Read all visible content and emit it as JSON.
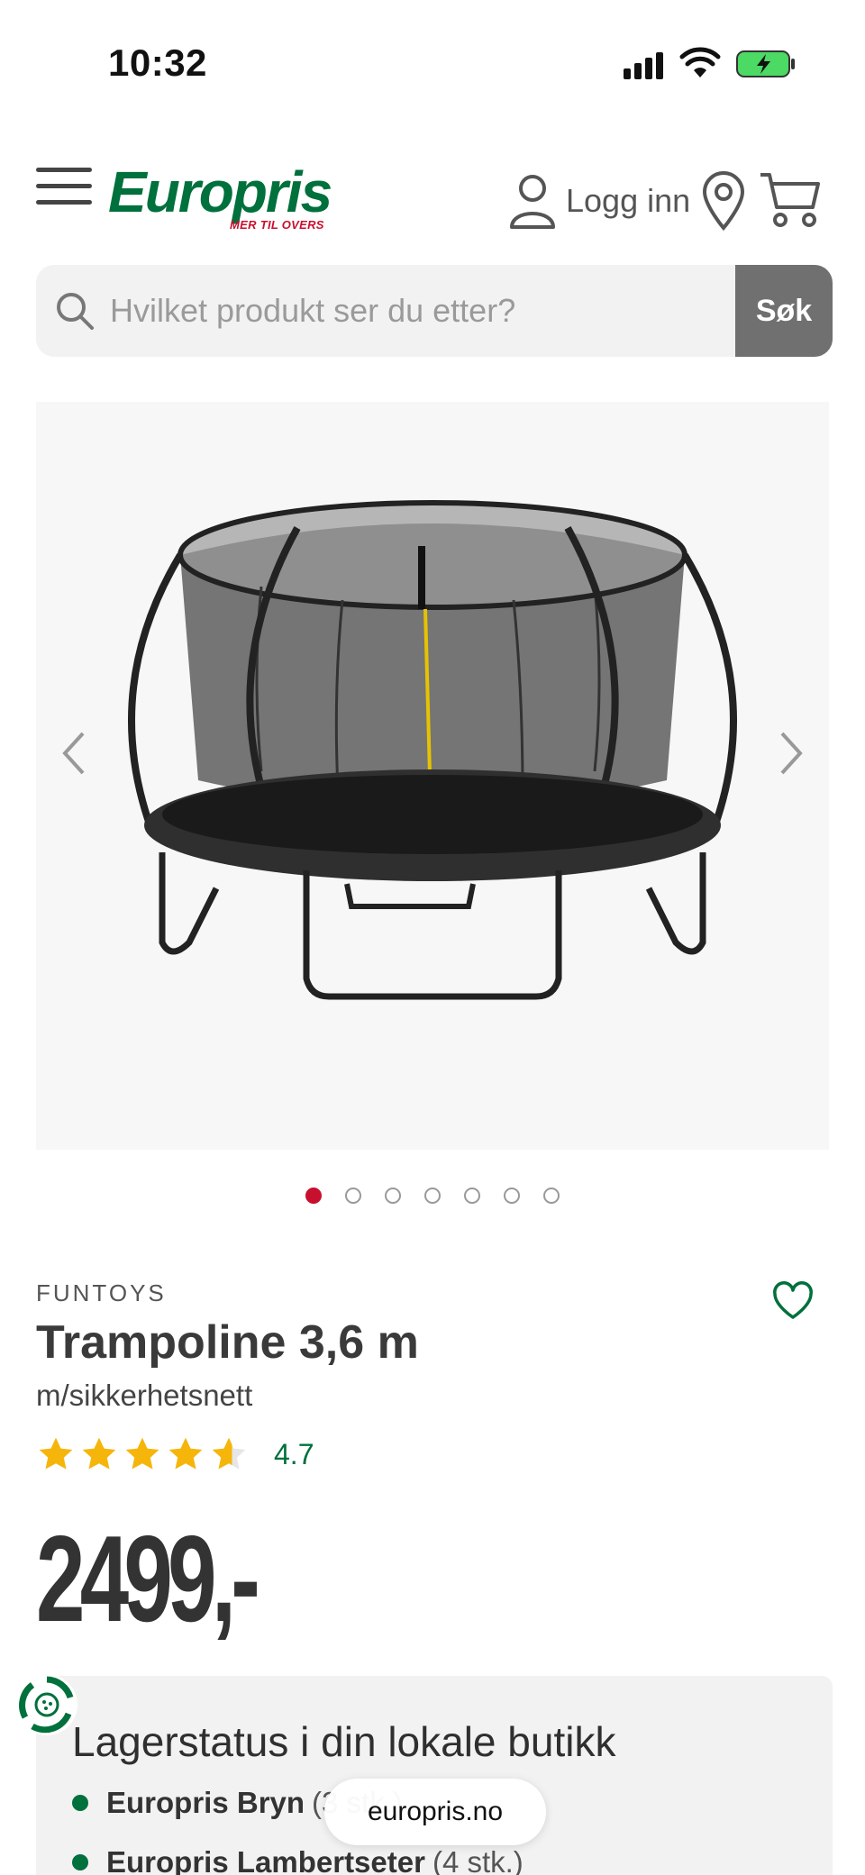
{
  "status_bar": {
    "time": "10:32"
  },
  "header": {
    "logo_text": "Europris",
    "logo_tagline": "MER TIL OVERS",
    "login_label": "Logg inn",
    "brand_color": "#00703c",
    "accent_color": "#c8102e"
  },
  "search": {
    "placeholder": "Hvilket produkt ser du etter?",
    "value": "",
    "button_label": "Søk"
  },
  "gallery": {
    "image_count": 7,
    "active_index": 0,
    "image_icon": "trampoline-product-image"
  },
  "product": {
    "brand": "FUNTOYS",
    "title": "Trampoline 3,6 m",
    "subtitle": "m/sikkerhetsnett",
    "rating": 4.7,
    "rating_label": "4.7",
    "price": "2499,-"
  },
  "stock": {
    "title": "Lagerstatus i din lokale butikk",
    "stores": [
      {
        "name": "Europris Bryn",
        "count": "(3 stk.)"
      },
      {
        "name": "Europris Lambertseter",
        "count": "(4 stk.)"
      }
    ]
  },
  "browser": {
    "url": "europris.no"
  }
}
